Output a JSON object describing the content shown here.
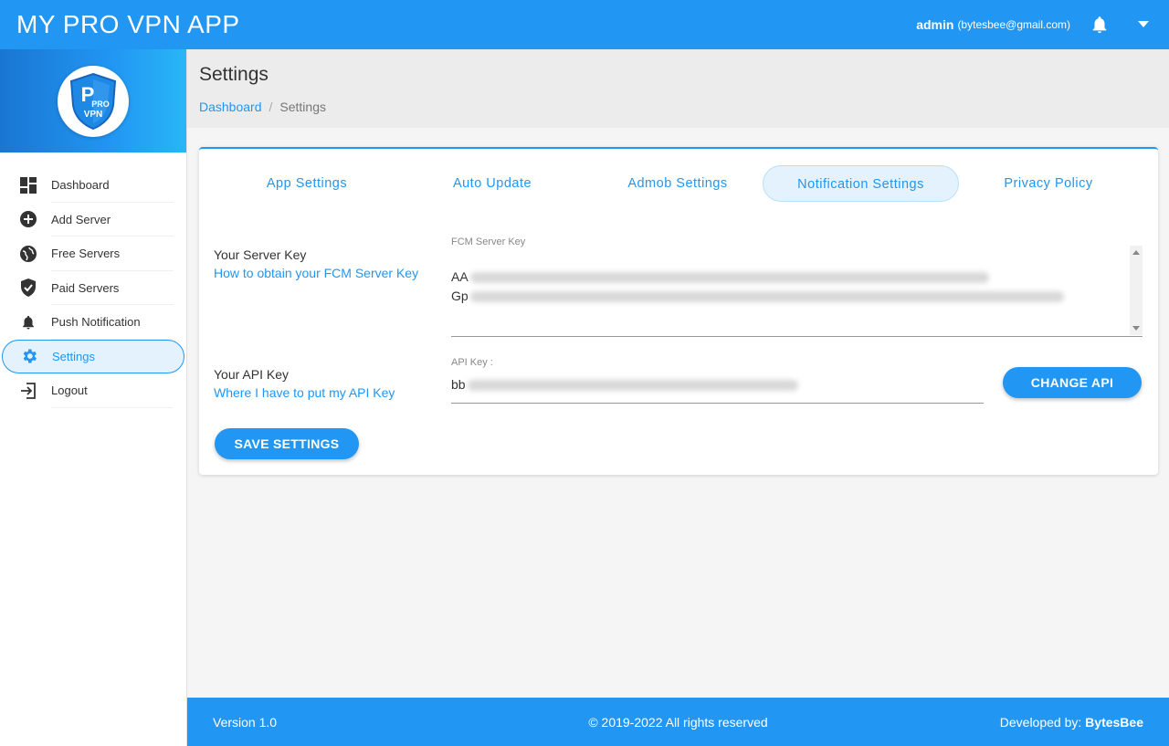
{
  "header": {
    "app_title": "MY PRO VPN APP",
    "user_name": "admin",
    "user_email": "(bytesbee@gmail.com)"
  },
  "sidebar": {
    "logo_text_top": "PRO",
    "logo_text_bottom": "VPN",
    "items": [
      {
        "label": "Dashboard",
        "icon": "dashboard-icon"
      },
      {
        "label": "Add Server",
        "icon": "add-circle-icon"
      },
      {
        "label": "Free Servers",
        "icon": "globe-icon"
      },
      {
        "label": "Paid Servers",
        "icon": "shield-check-icon"
      },
      {
        "label": "Push Notification",
        "icon": "bell-icon"
      },
      {
        "label": "Settings",
        "icon": "gear-icon",
        "active": true
      },
      {
        "label": "Logout",
        "icon": "logout-icon"
      }
    ]
  },
  "page": {
    "title": "Settings",
    "breadcrumb_home": "Dashboard",
    "breadcrumb_sep": "/",
    "breadcrumb_current": "Settings"
  },
  "tabs": [
    {
      "label": "App Settings"
    },
    {
      "label": "Auto Update"
    },
    {
      "label": "Admob Settings"
    },
    {
      "label": "Notification Settings",
      "active": true
    },
    {
      "label": "Privacy Policy"
    }
  ],
  "server_key": {
    "label": "Your Server Key",
    "link": "How to obtain your FCM Server Key",
    "field_caption": "FCM Server Key",
    "line1_prefix": "AA",
    "line2_prefix": "Gp"
  },
  "api_key": {
    "label": "Your API Key",
    "link": "Where I have to put my API Key",
    "field_caption": "API Key :",
    "value_prefix": "bb",
    "change_button": "CHANGE API"
  },
  "save_button": "SAVE SETTINGS",
  "footer": {
    "version": "Version 1.0",
    "copyright": "© 2019-2022 All rights reserved",
    "developed_by_label": "Developed by:",
    "developer": "BytesBee"
  },
  "colors": {
    "primary": "#2196f3",
    "active_bg": "#e3f2fd"
  }
}
